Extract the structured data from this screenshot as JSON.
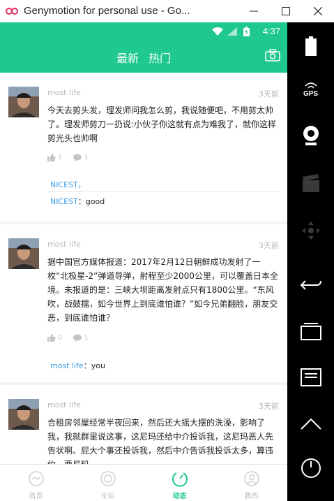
{
  "window": {
    "title": "Genymotion for personal use - Go...",
    "minimize_icon": "minimize-icon",
    "maximize_icon": "maximize-icon",
    "close_icon": "close-icon"
  },
  "statusbar": {
    "time": "4:37"
  },
  "appbar": {
    "tabs": [
      {
        "label": "最新"
      },
      {
        "label": "热门"
      }
    ],
    "camera_icon": "camera-icon"
  },
  "colors": {
    "accent": "#1ec88e",
    "link": "#3d9ee6"
  },
  "posts": [
    {
      "user": "most life",
      "time": "3天前",
      "content": "今天去剪头发，理发师问我怎么剪，我说随便吧，不用剪太帅了。理发师剪刀一扔说:小伙子你这就有点为难我了，就你这样剪光头也帅啊",
      "likes": "1",
      "comments": "1",
      "replies": [
        {
          "who": "NICEST，",
          "text": ""
        },
        {
          "who": "NICEST",
          "text": "：good"
        }
      ]
    },
    {
      "user": "most life",
      "time": "3天前",
      "content": "据中国官方媒体报道：2017年2月12日朝鲜成功发射了一枚“北极星-2”弹道导弹，射程至少2000公里，可以覆盖日本全境。未报道的是：三峡大坝距离发射点只有1800公里。“东风吹，战鼓擂，如今世界上到底谁怕谁？”如今兄弟翻脸，朋友交恶，到底谁怕谁？",
      "likes": "0",
      "comments": "1",
      "replies": [
        {
          "who": "most life",
          "text": "：you"
        }
      ]
    },
    {
      "user": "most life",
      "time": "3天前",
      "content": "合租房邻屋经常半夜回来，然后还大摇大摆的洗澡，影响了我，我就群里说这事，这尼玛还给中介投诉我，这尼玛恶人先告状啊。屁大个事还投诉我，然后中介告诉我投诉太多，算违约，要尼玛"
    }
  ],
  "bottomnav": [
    {
      "label": "首页",
      "icon": "home-icon"
    },
    {
      "label": "论坛",
      "icon": "forum-icon"
    },
    {
      "label": "动态",
      "icon": "dynamic-icon",
      "active": true
    },
    {
      "label": "我的",
      "icon": "profile-icon"
    }
  ],
  "sidepanel": {
    "gps_label": "GPS",
    "items": [
      "battery-icon",
      "gps-icon",
      "webcam-icon",
      "video-capture-icon",
      "dpad-icon",
      "back-icon",
      "recent-apps-icon",
      "menu-icon",
      "home-icon",
      "power-icon"
    ]
  }
}
